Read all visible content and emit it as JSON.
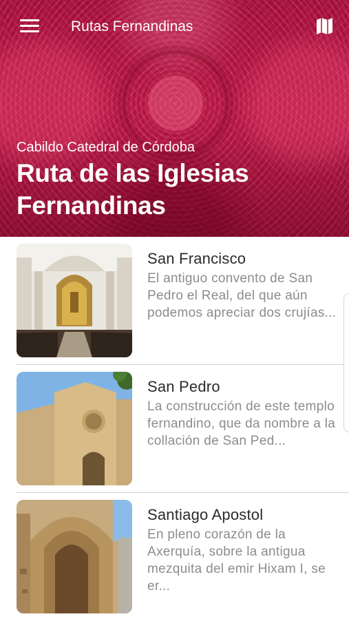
{
  "header": {
    "app_title": "Rutas Fernandinas",
    "menu_icon": "hamburger-menu-icon",
    "map_icon": "map-icon"
  },
  "hero": {
    "subtitle": "Cabildo Catedral de Córdoba",
    "title": "Ruta de las Iglesias Fernandinas",
    "accent_color": "#c8184a"
  },
  "churches": [
    {
      "name": "San Francisco",
      "description": "El antiguo convento de San Pedro el Real, del que aún podemos apreciar dos crujías..."
    },
    {
      "name": "San Pedro",
      "description": "La construcción de este templo fernandino, que da nombre a la collación de San Ped..."
    },
    {
      "name": "Santiago Apostol",
      "description": "En pleno corazón de la Axerquía, sobre la antigua mezquita del emir Hixam I, se er..."
    }
  ]
}
